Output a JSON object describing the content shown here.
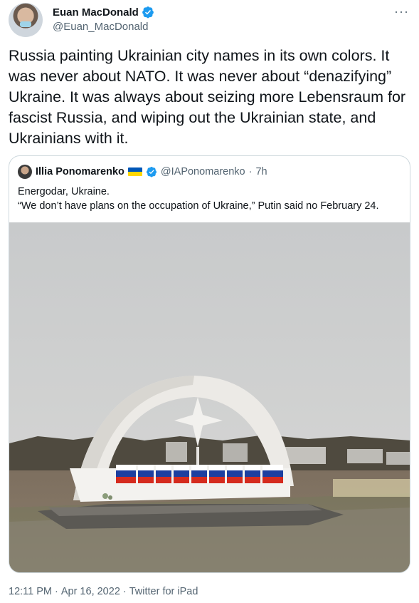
{
  "author": {
    "display_name": "Euan MacDonald",
    "handle": "@Euan_MacDonald",
    "verified": true
  },
  "more_label": "···",
  "tweet": {
    "text": "Russia painting Ukrainian city names in its own colors. It was never about NATO. It was never about “denazifying” Ukraine. It was always about seizing more Lebensraum for fascist Russia, and wiping out the Ukrainian state, and Ukrainians with it."
  },
  "quoted": {
    "display_name": "Illia Ponomarenko",
    "flag": "ukraine-flag",
    "verified": true,
    "handle": "@IAPonomarenko",
    "separator": "·",
    "time": "7h",
    "line1": "Energodar, Ukraine.",
    "line2": "“We don’t have plans on the occupation of Ukraine,” Putin said no February 24."
  },
  "footer": {
    "time": "12:11 PM",
    "separator1": "·",
    "date": "Apr 16, 2022",
    "separator2": "·",
    "source": "Twitter for iPad"
  },
  "colors": {
    "verified_blue": "#1d9bf0",
    "flag_blue": "#0057b7",
    "flag_yellow": "#ffd700",
    "ru_white": "#ffffff",
    "ru_blue": "#1c3fa0",
    "ru_red": "#d52b1e"
  }
}
